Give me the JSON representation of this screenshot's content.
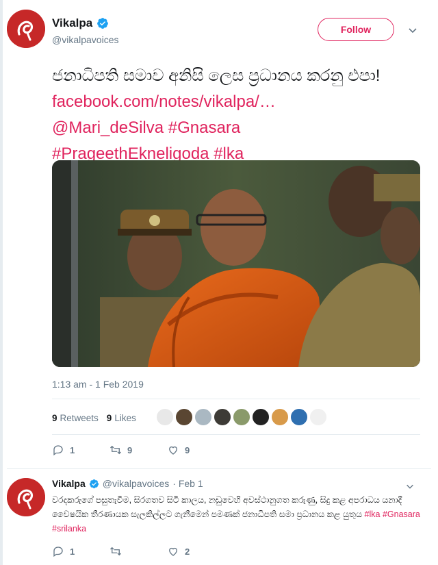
{
  "tweet": {
    "author": {
      "name": "Vikalpa",
      "handle": "@vikalpavoices",
      "verified": true
    },
    "follow_label": "Follow",
    "text_plain": "ජනාධිපති සමාව අනිසි ලෙස ප්‍රධානය කරනු එපා!",
    "links": [
      "facebook.com/notes/vikalpa/…",
      "@Mari_deSilva",
      "#Gnasara",
      "#PrageethEkneligoda",
      "#lka"
    ],
    "timestamp": "1:13 am - 1 Feb 2019",
    "stats": {
      "retweets_count": "9",
      "retweets_label": "Retweets",
      "likes_count": "9",
      "likes_label": "Likes"
    },
    "actions": {
      "replies": "1",
      "retweets": "9",
      "likes": "9"
    }
  },
  "reply": {
    "author_name": "Vikalpa",
    "author_handle": "@vikalpavoices",
    "date": "· Feb 1",
    "text_plain": "වරදකරුගේ පසුතැවීම, සිරගතව සිටි කාලය, නඩුවෙහි අවස්ථානුගත කරුණු, සිදු කළ අපරාධය යනාදී වෛෂයික තීරණායක සැලකිල්ලට ගැනීමෙන් පමණක් ජනාධිපති සමා ප්‍රධානය කළ යුතුය",
    "tags": [
      "#lka",
      "#Gnasara",
      "#srilanka"
    ],
    "actions": {
      "replies": "1",
      "retweets": "",
      "likes": "2"
    }
  },
  "colors": {
    "accent": "#e0245e",
    "verified": "#1da1f2",
    "muted": "#657786",
    "text": "#14171a",
    "avatar_bg": "#c62828"
  },
  "icons": [
    "verified-badge-icon",
    "chevron-down-icon",
    "reply-icon",
    "retweet-icon",
    "like-icon"
  ]
}
